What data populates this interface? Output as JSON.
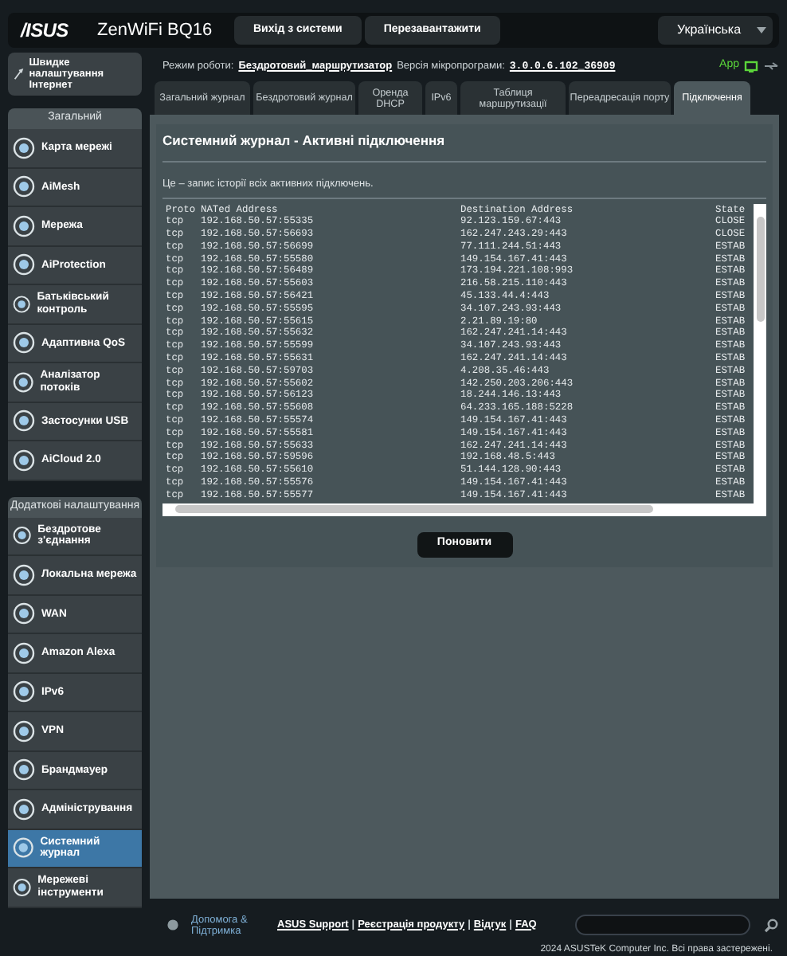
{
  "header": {
    "logo": "/ISUS",
    "model": "ZenWiFi BQ16",
    "buttons": [
      "Вихід з системи",
      "Перезавантажити"
    ],
    "language": "Українська"
  },
  "sidebar": {
    "quick_setup": "Швидке налаштування Інтернет",
    "sections": [
      {
        "title": "Загальний",
        "items": [
          {
            "label": "Карта мережі",
            "selected": false
          },
          {
            "label": "AiMesh",
            "selected": false
          },
          {
            "label": "Мережа",
            "selected": false
          },
          {
            "label": "AiProtection",
            "selected": false
          },
          {
            "label": "Батьківський контроль",
            "selected": false
          },
          {
            "label": "Адаптивна QoS",
            "selected": false
          },
          {
            "label": "Аналізатор потоків",
            "selected": false
          },
          {
            "label": "Застосунки USB",
            "selected": false
          },
          {
            "label": "AiCloud 2.0",
            "selected": false
          }
        ]
      },
      {
        "title": "Додаткові налаштування",
        "items": [
          {
            "label": "Бездротове з'єднання",
            "selected": false
          },
          {
            "label": "Локальна мережа",
            "selected": false
          },
          {
            "label": "WAN",
            "selected": false
          },
          {
            "label": "Amazon Alexa",
            "selected": false
          },
          {
            "label": "IPv6",
            "selected": false
          },
          {
            "label": "VPN",
            "selected": false
          },
          {
            "label": "Брандмауер",
            "selected": false
          },
          {
            "label": "Адміністрування",
            "selected": false
          },
          {
            "label": "Системний журнал",
            "selected": true
          },
          {
            "label": "Мережеві інструменти",
            "selected": false
          }
        ]
      }
    ]
  },
  "info": {
    "mode_label": "Режим роботи:",
    "mode": "Бездротовий_маршрутизатор",
    "firmware_label": "Версія мікропрограми:",
    "firmware": "3.0.0.6.102_36909",
    "app": "App"
  },
  "tabs": [
    {
      "label": "Загальний журнал",
      "selected": false
    },
    {
      "label": "Бездротовий журнал",
      "selected": false
    },
    {
      "label": "Оренда DHCP",
      "selected": false
    },
    {
      "label": "IPv6",
      "selected": false
    },
    {
      "label": "Таблиця маршрутизації",
      "selected": false
    },
    {
      "label": "Переадресація порту",
      "selected": false
    },
    {
      "label": "Підключення",
      "selected": true
    }
  ],
  "panel": {
    "title": "Системний журнал - Активні підключення",
    "description": "Це – запис історії всіх активних підключень.",
    "columns": [
      "Proto",
      "NATed Address",
      "Destination Address",
      "State"
    ],
    "rows": [
      [
        "tcp",
        "192.168.50.57:55335",
        "92.123.159.67:443",
        "CLOSE"
      ],
      [
        "tcp",
        "192.168.50.57:56693",
        "162.247.243.29:443",
        "CLOSE"
      ],
      [
        "tcp",
        "192.168.50.57:56699",
        "77.111.244.51:443",
        "ESTAB"
      ],
      [
        "tcp",
        "192.168.50.57:55580",
        "149.154.167.41:443",
        "ESTAB"
      ],
      [
        "tcp",
        "192.168.50.57:56489",
        "173.194.221.108:993",
        "ESTAB"
      ],
      [
        "tcp",
        "192.168.50.57:55603",
        "216.58.215.110:443",
        "ESTAB"
      ],
      [
        "tcp",
        "192.168.50.57:56421",
        "45.133.44.4:443",
        "ESTAB"
      ],
      [
        "tcp",
        "192.168.50.57:55595",
        "34.107.243.93:443",
        "ESTAB"
      ],
      [
        "tcp",
        "192.168.50.57:55615",
        "2.21.89.19:80",
        "ESTAB"
      ],
      [
        "tcp",
        "192.168.50.57:55632",
        "162.247.241.14:443",
        "ESTAB"
      ],
      [
        "tcp",
        "192.168.50.57:55599",
        "34.107.243.93:443",
        "ESTAB"
      ],
      [
        "tcp",
        "192.168.50.57:55631",
        "162.247.241.14:443",
        "ESTAB"
      ],
      [
        "tcp",
        "192.168.50.57:59703",
        "4.208.35.46:443",
        "ESTAB"
      ],
      [
        "tcp",
        "192.168.50.57:55602",
        "142.250.203.206:443",
        "ESTAB"
      ],
      [
        "tcp",
        "192.168.50.57:56123",
        "18.244.146.13:443",
        "ESTAB"
      ],
      [
        "tcp",
        "192.168.50.57:55608",
        "64.233.165.188:5228",
        "ESTAB"
      ],
      [
        "tcp",
        "192.168.50.57:55574",
        "149.154.167.41:443",
        "ESTAB"
      ],
      [
        "tcp",
        "192.168.50.57:55581",
        "149.154.167.41:443",
        "ESTAB"
      ],
      [
        "tcp",
        "192.168.50.57:55633",
        "162.247.241.14:443",
        "ESTAB"
      ],
      [
        "tcp",
        "192.168.50.57:59596",
        "192.168.48.5:443",
        "ESTAB"
      ],
      [
        "tcp",
        "192.168.50.57:55610",
        "51.144.128.90:443",
        "ESTAB"
      ],
      [
        "tcp",
        "192.168.50.57:55576",
        "149.154.167.41:443",
        "ESTAB"
      ],
      [
        "tcp",
        "192.168.50.57:55577",
        "149.154.167.41:443",
        "ESTAB"
      ]
    ],
    "refresh_button": "Поновити"
  },
  "footer": {
    "help": "Допомога & Підтримка",
    "links": [
      {
        "kind": "link",
        "text": "ASUS Support"
      },
      {
        "kind": "separator",
        "text": "|"
      },
      {
        "kind": "link",
        "text": "Реєстрація продукту"
      },
      {
        "kind": "separator",
        "text": "|"
      },
      {
        "kind": "link",
        "text": "Відгук"
      },
      {
        "kind": "separator",
        "text": "|"
      },
      {
        "kind": "link",
        "text": "FAQ"
      }
    ],
    "copyright": "2024 ASUSTeK Computer Inc. Всі права застережені."
  }
}
